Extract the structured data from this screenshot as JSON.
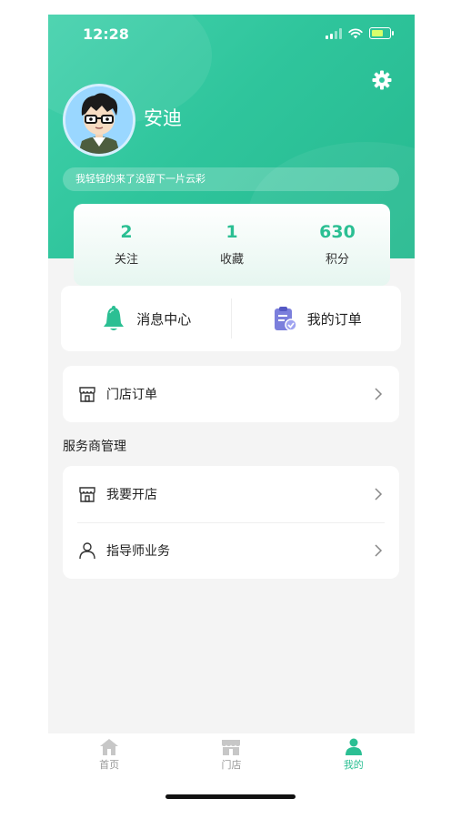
{
  "status_bar": {
    "time": "12:28"
  },
  "profile": {
    "name": "安迪",
    "signature": "我轻轻的来了没留下一片云彩"
  },
  "stats": [
    {
      "value": "2",
      "label": "关注"
    },
    {
      "value": "1",
      "label": "收藏"
    },
    {
      "value": "630",
      "label": "积分"
    }
  ],
  "quick_actions": {
    "messages": "消息中心",
    "orders": "我的订单"
  },
  "store_orders": {
    "label": "门店订单"
  },
  "service_section": {
    "title": "服务商管理",
    "items": [
      "我要开店",
      "指导师业务"
    ]
  },
  "tabbar": {
    "items": [
      "首页",
      "门店",
      "我的"
    ],
    "active_index": 2
  },
  "colors": {
    "accent": "#2bbf93",
    "header_start": "#43d1ac",
    "header_end": "#26b98f",
    "order_icon": "#7b7fdc"
  }
}
